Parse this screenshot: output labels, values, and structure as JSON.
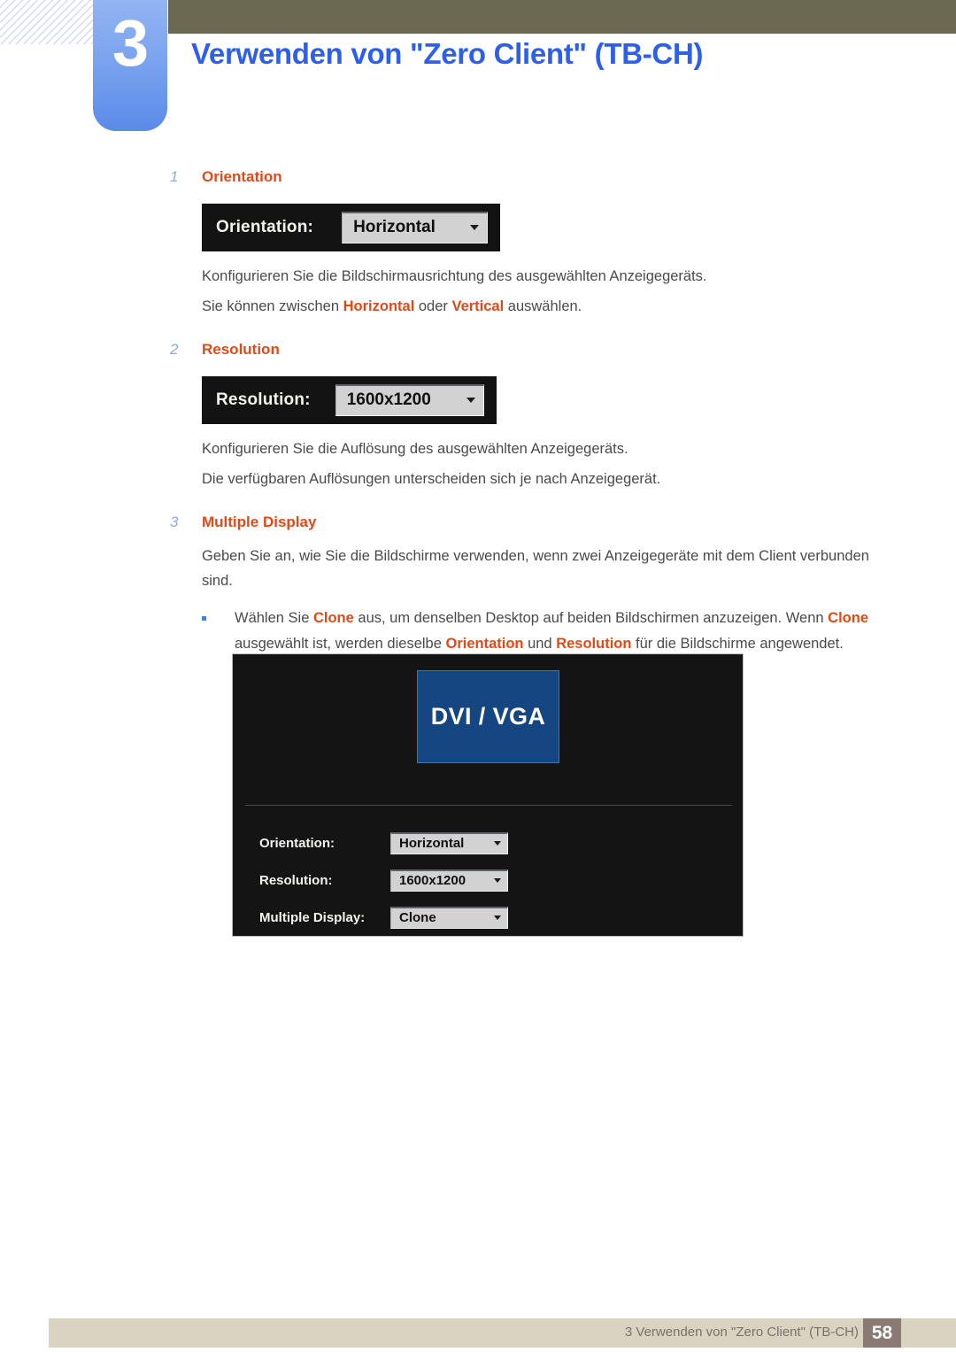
{
  "header": {
    "chapter_number": "3",
    "title": "Verwenden von \"Zero Client\" (TB-CH)",
    "band_color": "#6c6953",
    "tab_color": "#7ba4ef",
    "title_color": "#2d5fe8"
  },
  "steps": [
    {
      "number": "1",
      "title": "Orientation",
      "widget": {
        "label": "Orientation:",
        "value": "Horizontal",
        "caret": "chevron-down-icon"
      },
      "paragraphs": [
        "Konfigurieren Sie die Bildschirmausrichtung des ausgewählten Anzeigegeräts."
      ],
      "rich_paragraph": {
        "before": "Sie können zwischen ",
        "hl1": "Horizontal",
        "mid": " oder ",
        "hl2": "Vertical",
        "after": " auswählen."
      }
    },
    {
      "number": "2",
      "title": "Resolution",
      "widget": {
        "label": "Resolution:",
        "value": "1600x1200",
        "caret": "chevron-down-icon"
      },
      "paragraphs": [
        "Konfigurieren Sie die Auflösung des ausgewählten Anzeigegeräts.",
        "Die verfügbaren Auflösungen unterscheiden sich je nach Anzeigegerät."
      ]
    },
    {
      "number": "3",
      "title": "Multiple Display",
      "paragraphs": [
        "Geben Sie an, wie Sie die Bildschirme verwenden, wenn zwei Anzeigegeräte mit dem Client verbunden sind."
      ],
      "bullet": {
        "p1": "Wählen Sie ",
        "hl1": "Clone",
        "p2": " aus, um denselben Desktop auf beiden Bildschirmen anzuzeigen. Wenn ",
        "hl2": "Clone",
        "p3": " ausgewählt ist, werden dieselbe ",
        "hl3": "Orientation",
        "p4": " und ",
        "hl4": "Resolution",
        "p5": " für die Bildschirme angewendet."
      }
    }
  ],
  "panel": {
    "monitor_label": "DVI / VGA",
    "monitor_color": "#154682",
    "background_color": "#141414",
    "rows": [
      {
        "label": "Orientation:",
        "value": "Horizontal",
        "caret": "chevron-down-icon"
      },
      {
        "label": "Resolution:",
        "value": "1600x1200",
        "caret": "chevron-down-icon"
      },
      {
        "label": "Multiple Display:",
        "value": "Clone",
        "caret": "chevron-down-icon"
      }
    ]
  },
  "footer": {
    "text": "3 Verwenden von \"Zero Client\" (TB-CH)",
    "page_number": "58",
    "bar_color": "#d9d4c2",
    "page_box_color": "#8b7a74"
  }
}
